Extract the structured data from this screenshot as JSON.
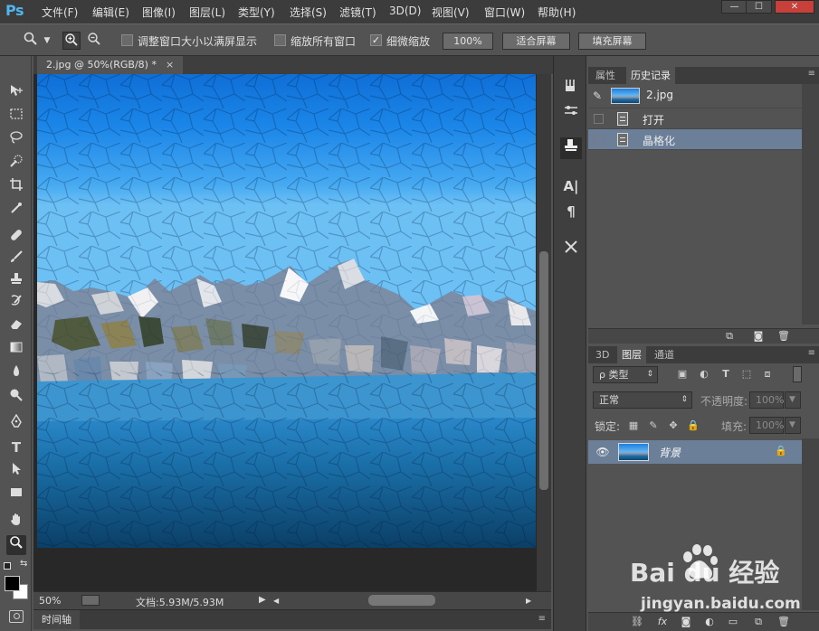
{
  "app": {
    "logo": "Ps",
    "menus": [
      "文件(F)",
      "编辑(E)",
      "图像(I)",
      "图层(L)",
      "类型(Y)",
      "选择(S)",
      "滤镜(T)",
      "3D(D)",
      "视图(V)",
      "窗口(W)",
      "帮助(H)"
    ],
    "window_buttons": [
      "—",
      "☐",
      "✕"
    ]
  },
  "options": {
    "resize_windows_label": "调整窗口大小以满屏显示",
    "zoom_all_label": "缩放所有窗口",
    "scrubby_zoom_label": "细微缩放",
    "scrubby_zoom_checked": true,
    "zoom_100_button": "100%",
    "fit_screen_button": "适合屏幕",
    "fill_screen_button": "填充屏幕"
  },
  "document": {
    "tab_title": "2.jpg @ 50%(RGB/8) *",
    "close_glyph": "×",
    "zoom": "50%",
    "doc_size": "文档:5.93M/5.93M",
    "timeline_label": "时间轴"
  },
  "history_panel": {
    "tabs": [
      "属性",
      "历史记录"
    ],
    "active_tab": "历史记录",
    "snapshot_name": "2.jpg",
    "items": [
      {
        "label": "打开",
        "selected": false
      },
      {
        "label": "晶格化",
        "selected": true
      }
    ]
  },
  "layers_panel": {
    "tabs": [
      "3D",
      "图层",
      "通道"
    ],
    "active_tab": "图层",
    "filter_label": "ρ 类型",
    "blend_mode": "正常",
    "opacity_label": "不透明度:",
    "opacity_value": "100%",
    "lock_label": "锁定:",
    "fill_label": "填充:",
    "fill_value": "100%",
    "layers": [
      {
        "name": "背景",
        "locked": true,
        "visible": true
      }
    ]
  },
  "watermark": {
    "main": "Bai du 经验",
    "sub": "jingyan.baidu.com"
  },
  "colors": {
    "accent_selected": "#6b7f99",
    "ps_logo": "#4fb6f0"
  }
}
